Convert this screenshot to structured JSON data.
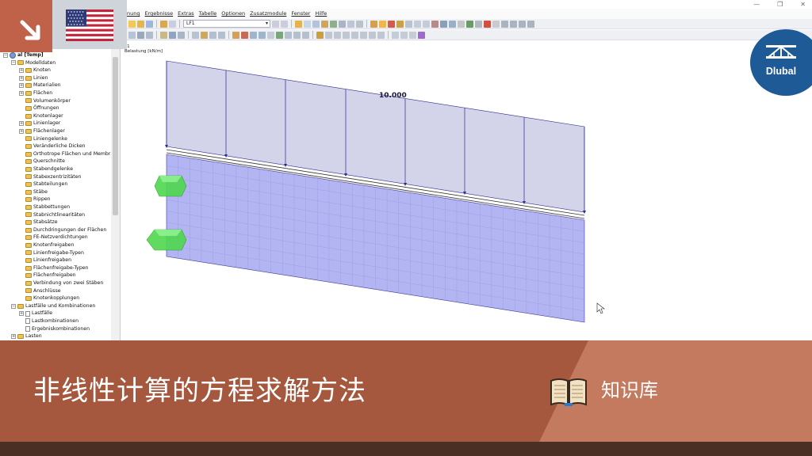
{
  "window": {
    "controls": [
      "—",
      "❐",
      "✕"
    ]
  },
  "menubar": [
    "nung",
    "Ergebnisse",
    "Extras",
    "Tabelle",
    "Optionen",
    "Zusatzmodule",
    "Fenster",
    "Hilfe"
  ],
  "toolbar": {
    "load_case_select": "LF1"
  },
  "navigator": {
    "items": [
      {
        "label": "al [Temp]",
        "level": 0,
        "expander": "−",
        "icon": "root",
        "bold": true
      },
      {
        "label": "Modelldaten",
        "level": 1,
        "expander": "−",
        "icon": "folder"
      },
      {
        "label": "Knoten",
        "level": 2,
        "expander": "+",
        "icon": "folder"
      },
      {
        "label": "Linien",
        "level": 2,
        "expander": "+",
        "icon": "folder"
      },
      {
        "label": "Materialien",
        "level": 2,
        "expander": "+",
        "icon": "folder"
      },
      {
        "label": "Flächen",
        "level": 2,
        "expander": "+",
        "icon": "folder"
      },
      {
        "label": "Volumenkörper",
        "level": 2,
        "expander": "",
        "icon": "folder"
      },
      {
        "label": "Öffnungen",
        "level": 2,
        "expander": "",
        "icon": "folder"
      },
      {
        "label": "Knotenlager",
        "level": 2,
        "expander": "",
        "icon": "folder"
      },
      {
        "label": "Linienlager",
        "level": 2,
        "expander": "+",
        "icon": "folder"
      },
      {
        "label": "Flächenlager",
        "level": 2,
        "expander": "+",
        "icon": "folder"
      },
      {
        "label": "Liniengelenke",
        "level": 2,
        "expander": "",
        "icon": "folder"
      },
      {
        "label": "Veränderliche Dicken",
        "level": 2,
        "expander": "",
        "icon": "folder"
      },
      {
        "label": "Orthotrope Flächen und Membra",
        "level": 2,
        "expander": "",
        "icon": "folder"
      },
      {
        "label": "Querschnitte",
        "level": 2,
        "expander": "",
        "icon": "folder"
      },
      {
        "label": "Stabendgelenke",
        "level": 2,
        "expander": "",
        "icon": "folder"
      },
      {
        "label": "Stabexzentrizitäten",
        "level": 2,
        "expander": "",
        "icon": "folder"
      },
      {
        "label": "Stabteilungen",
        "level": 2,
        "expander": "",
        "icon": "folder"
      },
      {
        "label": "Stäbe",
        "level": 2,
        "expander": "",
        "icon": "folder"
      },
      {
        "label": "Rippen",
        "level": 2,
        "expander": "",
        "icon": "folder"
      },
      {
        "label": "Stabbettungen",
        "level": 2,
        "expander": "",
        "icon": "folder"
      },
      {
        "label": "Stabnichtlinearitäten",
        "level": 2,
        "expander": "",
        "icon": "folder"
      },
      {
        "label": "Stabsätze",
        "level": 2,
        "expander": "",
        "icon": "folder"
      },
      {
        "label": "Durchdringungen der Flächen",
        "level": 2,
        "expander": "",
        "icon": "folder"
      },
      {
        "label": "FE-Netzverdichtungen",
        "level": 2,
        "expander": "",
        "icon": "folder"
      },
      {
        "label": "Knotenfreigaben",
        "level": 2,
        "expander": "",
        "icon": "folder"
      },
      {
        "label": "Linienfreigabe-Typen",
        "level": 2,
        "expander": "",
        "icon": "folder"
      },
      {
        "label": "Linienfreigaben",
        "level": 2,
        "expander": "",
        "icon": "folder"
      },
      {
        "label": "Flächenfreigabe-Typen",
        "level": 2,
        "expander": "",
        "icon": "folder"
      },
      {
        "label": "Flächenfreigaben",
        "level": 2,
        "expander": "",
        "icon": "folder"
      },
      {
        "label": "Verbindung von zwei Stäben",
        "level": 2,
        "expander": "",
        "icon": "folder"
      },
      {
        "label": "Anschlüsse",
        "level": 2,
        "expander": "",
        "icon": "folder"
      },
      {
        "label": "Knotenkopplungen",
        "level": 2,
        "expander": "",
        "icon": "folder"
      },
      {
        "label": "Lastfälle und Kombinationen",
        "level": 1,
        "expander": "−",
        "icon": "folder"
      },
      {
        "label": "Lastfälle",
        "level": 2,
        "expander": "+",
        "icon": "page"
      },
      {
        "label": "Lastkombinationen",
        "level": 2,
        "expander": "",
        "icon": "page"
      },
      {
        "label": "Ergebniskombinationen",
        "level": 2,
        "expander": "",
        "icon": "page"
      },
      {
        "label": "Lasten",
        "level": 1,
        "expander": "+",
        "icon": "folder"
      }
    ]
  },
  "viewport": {
    "info_line1": "F1",
    "info_line2": "Belastung [kN/m]",
    "load_value_label": "10.000"
  },
  "overlay": {
    "logo_text": "Dlubal",
    "flag": "usa-flag"
  },
  "banner": {
    "title": "非线性计算的方程求解方法",
    "knowledge_label": "知识库"
  },
  "colors": {
    "banner_dark": "#a5583e",
    "banner_light": "#c47a5f",
    "badge": "#c0624a",
    "logo_blue": "#1d5a96",
    "load_fill": "#d3d3ea",
    "plate_fill": "#b3b4f2",
    "support_green": "#4fd84f"
  }
}
